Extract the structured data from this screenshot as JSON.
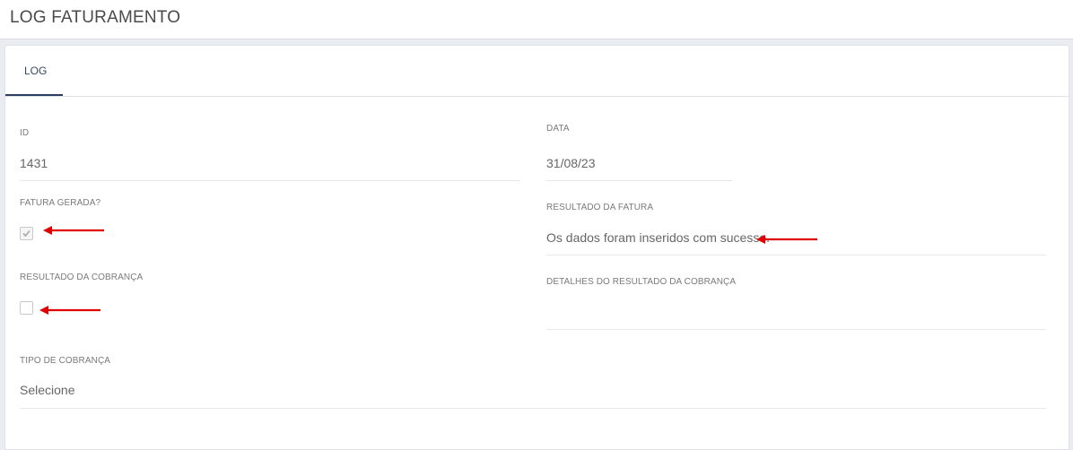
{
  "header": {
    "title": "LOG FATURAMENTO"
  },
  "tabs": [
    {
      "label": "LOG",
      "active": true
    }
  ],
  "form": {
    "id": {
      "label": "ID",
      "value": "1431"
    },
    "data": {
      "label": "DATA",
      "value": "31/08/23"
    },
    "fatura_gerada": {
      "label": "FATURA GERADA?",
      "checked": true
    },
    "resultado_fatura": {
      "label": "RESULTADO DA FATURA",
      "value": "Os dados foram inseridos com sucesso."
    },
    "resultado_cobranca": {
      "label": "RESULTADO DA COBRANÇA",
      "checked": false
    },
    "detalhes_resultado_cobranca": {
      "label": "DETALHES DO RESULTADO DA COBRANÇA",
      "value": ""
    },
    "tipo_cobranca": {
      "label": "TIPO DE COBRANÇA",
      "value": "Selecione"
    }
  },
  "colors": {
    "accent": "#2a3f5f",
    "annotation_arrow": "#e00000"
  },
  "icons": {
    "checkmark": "check-icon",
    "annotation": "red-arrow-icon"
  }
}
